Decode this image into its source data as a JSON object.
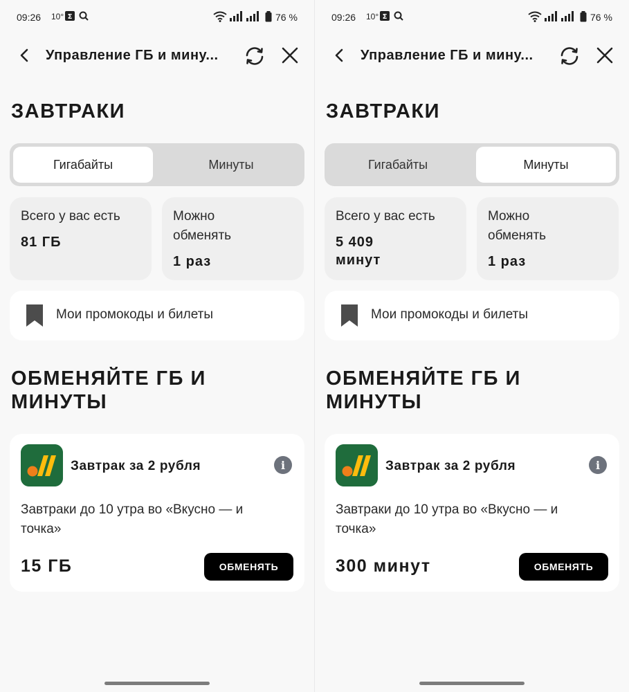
{
  "status_bar": {
    "time": "09:26",
    "temperature": "10°",
    "battery": "76 %"
  },
  "header": {
    "title": "Управление ГБ и мину..."
  },
  "page": {
    "title": "ЗАВТРАКИ",
    "promo_label": "Мои промокоды и билеты",
    "section_title": "ОБМЕНЯЙТЕ ГБ И МИНУТЫ"
  },
  "tabs": {
    "gigabytes": "Гигабайты",
    "minutes": "Минуты"
  },
  "balance": {
    "total_label": "Всего у вас есть",
    "exchange_label_line1": "Можно",
    "exchange_label_line2": "обменять",
    "exchange_times": "1 раз"
  },
  "offer": {
    "title": "Завтрак за 2 рубля",
    "desc": "Завтраки до 10 утра во «Вкусно — и точка»",
    "button": "ОБМЕНЯТЬ"
  },
  "screens": [
    {
      "active_tab": "gigabytes",
      "total_line1": "81 ГБ",
      "total_line2": "",
      "offer_amount": "15 ГБ"
    },
    {
      "active_tab": "minutes",
      "total_line1": "5 409",
      "total_line2": "минут",
      "offer_amount": "300 минут"
    }
  ],
  "colors": {
    "accent": "#000000",
    "logo_bg": "#1f6c3c",
    "logo_orange": "#ef7f1a",
    "logo_yellow": "#ffbc0d"
  },
  "icons": {
    "back": "chevron-left-icon",
    "refresh": "refresh-icon",
    "close": "close-icon",
    "promo": "bookmark-icon",
    "info": "info-icon"
  }
}
